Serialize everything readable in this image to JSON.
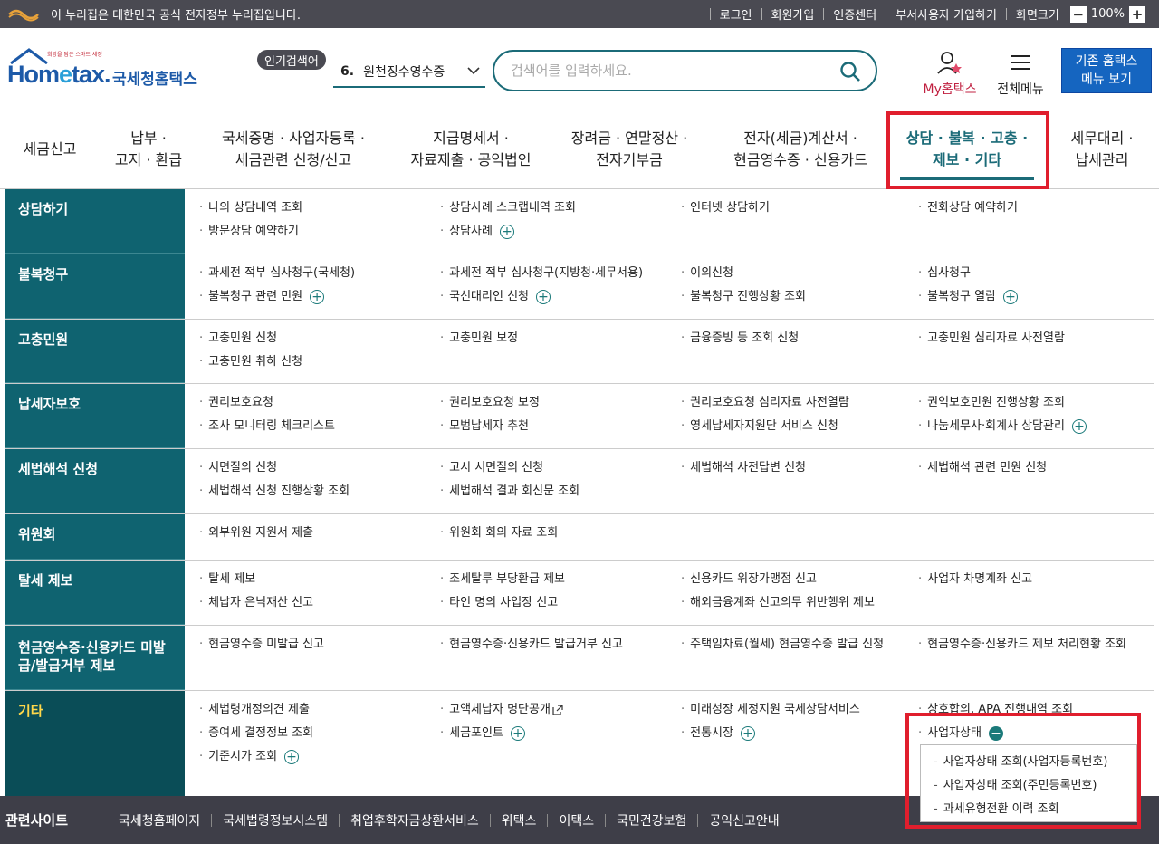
{
  "topbar": {
    "gov_notice": "이 누리집은 대한민국 공식 전자정부 누리집입니다.",
    "links": [
      "로그인",
      "회원가입",
      "인증센터",
      "부서사용자 가입하기",
      "화면크기"
    ],
    "zoom_minus": "−",
    "zoom_value": "100%",
    "zoom_plus": "+"
  },
  "header": {
    "logo_small": "희망을 담은 스마트 세정",
    "logo_text_1": "Hom",
    "logo_text_e": "e",
    "logo_text_2": "tax.",
    "logo_kr": "국세청홈택스",
    "popular_badge": "인기검색어",
    "popular_num": "6.",
    "popular_text": "원천징수영수증",
    "search_placeholder": "검색어를 입력하세요.",
    "my_hometax": "My홈택스",
    "all_menu": "전체메뉴",
    "old_home_line1": "기존 홈택스",
    "old_home_line2": "메뉴 보기"
  },
  "gnb": [
    {
      "l1": "세금신고",
      "l2": ""
    },
    {
      "l1": "납부 ·",
      "l2": "고지 · 환급"
    },
    {
      "l1": "국세증명 · 사업자등록 ·",
      "l2": "세금관련 신청/신고"
    },
    {
      "l1": "지급명세서 ·",
      "l2": "자료제출 · 공익법인"
    },
    {
      "l1": "장려금 · 연말정산 ·",
      "l2": "전자기부금"
    },
    {
      "l1": "전자(세금)계산서 ·",
      "l2": "현금영수증 · 신용카드"
    },
    {
      "l1": "상담 · 불복 · 고충 ·",
      "l2": "제보 · 기타"
    },
    {
      "l1": "세무대리 ·",
      "l2": "납세관리"
    }
  ],
  "categories": [
    {
      "title": "상담하기",
      "items": [
        "나의 상담내역 조회",
        "상담사례 스크랩내역 조회",
        "인터넷 상담하기",
        "전화상담 예약하기",
        "방문상담 예약하기",
        "상담사례"
      ]
    },
    {
      "title": "불복청구",
      "items": [
        "과세전 적부 심사청구(국세청)",
        "과세전 적부 심사청구(지방청·세무서용)",
        "이의신청",
        "심사청구",
        "불복청구 관련 민원",
        "국선대리인 신청",
        "불복청구 진행상황 조회",
        "불복청구 열람"
      ]
    },
    {
      "title": "고충민원",
      "items": [
        "고충민원 신청",
        "고충민원 보정",
        "금융증빙 등 조회 신청",
        "고충민원 심리자료 사전열람",
        "고충민원 취하 신청"
      ]
    },
    {
      "title": "납세자보호",
      "items": [
        "권리보호요청",
        "권리보호요청 보정",
        "권리보호요청 심리자료 사전열람",
        "권익보호민원 진행상황 조회",
        "조사 모니터링 체크리스트",
        "모범납세자 추천",
        "영세납세자지원단 서비스 신청",
        "나눔세무사·회계사 상담관리"
      ]
    },
    {
      "title": "세법해석 신청",
      "items": [
        "서면질의 신청",
        "고시 서면질의 신청",
        "세법해석 사전답변 신청",
        "세법해석 관련 민원 신청",
        "세법해석 신청 진행상황 조회",
        "세법해석 결과 회신문 조회"
      ]
    },
    {
      "title": "위원회",
      "items": [
        "외부위원 지원서 제출",
        "위원회 회의 자료 조회"
      ]
    },
    {
      "title": "탈세 제보",
      "items": [
        "탈세 제보",
        "조세탈루 부당환급 제보",
        "신용카드 위장가맹점 신고",
        "사업자 차명계좌 신고",
        "체납자 은닉재산 신고",
        "타인 명의 사업장 신고",
        "해외금융계좌 신고의무 위반행위 제보"
      ]
    },
    {
      "title": "현금영수증·신용카드 미발급/발급거부 제보",
      "items": [
        "현금영수증 미발급 신고",
        "현금영수증·신용카드 발급거부 신고",
        "주택임차료(월세) 현금영수증 발급 신청",
        "현금영수증·신용카드 제보 처리현황 조회"
      ]
    },
    {
      "title": "기타",
      "items": [
        "세법령개정의견 제출",
        "고액체납자 명단공개",
        "미래성장 세정지원 국세상담서비스",
        "상호합의, APA 진행내역 조회",
        "증여세 결정정보 조회",
        "세금포인트",
        "전통시장",
        "사업자상태",
        "기준시가 조회"
      ]
    }
  ],
  "subpanel": [
    "사업자상태 조회(사업자등록번호)",
    "사업자상태 조회(주민등록번호)",
    "과세유형전환 이력 조회"
  ],
  "footer": {
    "title": "관련사이트",
    "links": [
      "국세청홈페이지",
      "국세법령정보시스템",
      "취업후학자금상환서비스",
      "위택스",
      "이택스",
      "국민건강보험",
      "공익신고안내"
    ]
  },
  "icons": {
    "gov_logo": "gov-emblem-icon",
    "chevron": "chevron-down-icon",
    "search": "search-icon",
    "my": "user-icon",
    "menu": "hamburger-icon",
    "plus": "plus-circle-icon",
    "minus": "minus-circle-icon",
    "external": "external-link-icon"
  },
  "colors": {
    "accent": "#1b6b78",
    "highlight": "#e01e2d",
    "active_cat": "#ffd84a"
  }
}
